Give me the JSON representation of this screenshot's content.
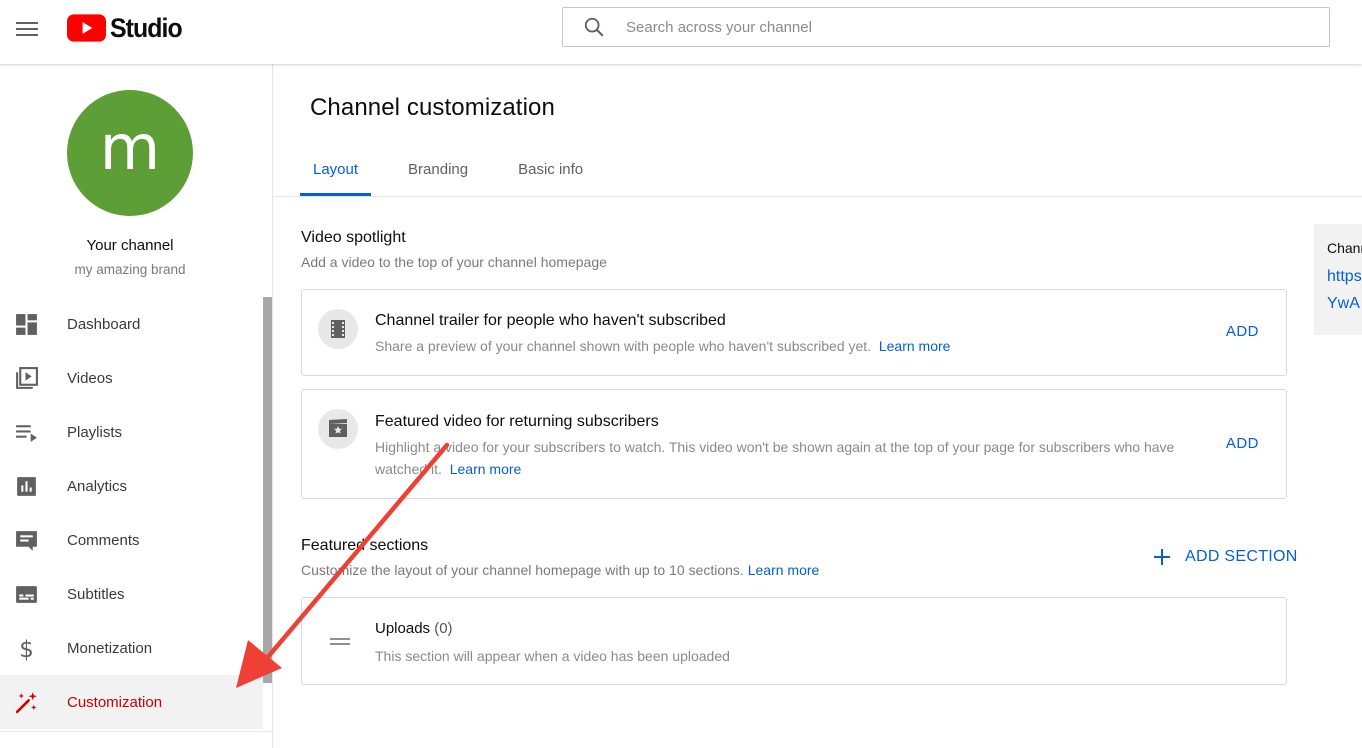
{
  "header": {
    "logo_text": "Studio",
    "search_placeholder": "Search across your channel"
  },
  "sidebar": {
    "avatar_letter": "m",
    "channel_title": "Your channel",
    "channel_subtitle": "my amazing brand",
    "items": [
      {
        "label": "Dashboard",
        "icon": "dashboard-icon"
      },
      {
        "label": "Videos",
        "icon": "videos-icon"
      },
      {
        "label": "Playlists",
        "icon": "playlists-icon"
      },
      {
        "label": "Analytics",
        "icon": "analytics-icon"
      },
      {
        "label": "Comments",
        "icon": "comments-icon"
      },
      {
        "label": "Subtitles",
        "icon": "subtitles-icon"
      },
      {
        "label": "Monetization",
        "icon": "dollar-icon"
      },
      {
        "label": "Customization",
        "icon": "magic-wand-icon",
        "active": true
      }
    ]
  },
  "main": {
    "page_title": "Channel customization",
    "tabs": [
      {
        "label": "Layout",
        "active": true
      },
      {
        "label": "Branding"
      },
      {
        "label": "Basic info"
      }
    ],
    "video_spotlight": {
      "title": "Video spotlight",
      "description": "Add a video to the top of your channel homepage",
      "cards": [
        {
          "title": "Channel trailer for people who haven't subscribed",
          "description": "Share a preview of your channel shown with people who haven't subscribed yet.",
          "link": "Learn more",
          "action": "ADD"
        },
        {
          "title": "Featured video for returning subscribers",
          "description_line1": "Highlight a video for your subscribers to watch. This video won't be shown again at the top of your page for subscribers who have",
          "description_line2": "watched it.",
          "link": "Learn more",
          "action": "ADD"
        }
      ]
    },
    "featured_sections": {
      "title": "Featured sections",
      "description": "Customize the layout of your channel homepage with up to 10 sections.",
      "link": "Learn more",
      "add_section": "ADD SECTION",
      "uploads": {
        "title": "Uploads",
        "count": "(0)",
        "description": "This section will appear when a video has been uploaded"
      }
    },
    "right_panel": {
      "label": "Chann",
      "url_line1": "https",
      "url_line2": "YwA"
    }
  },
  "colors": {
    "accent_blue": "#065fd4",
    "active_red": "#cc0000",
    "avatar_green": "#5e9e36",
    "annotation_arrow": "#ee4035"
  }
}
